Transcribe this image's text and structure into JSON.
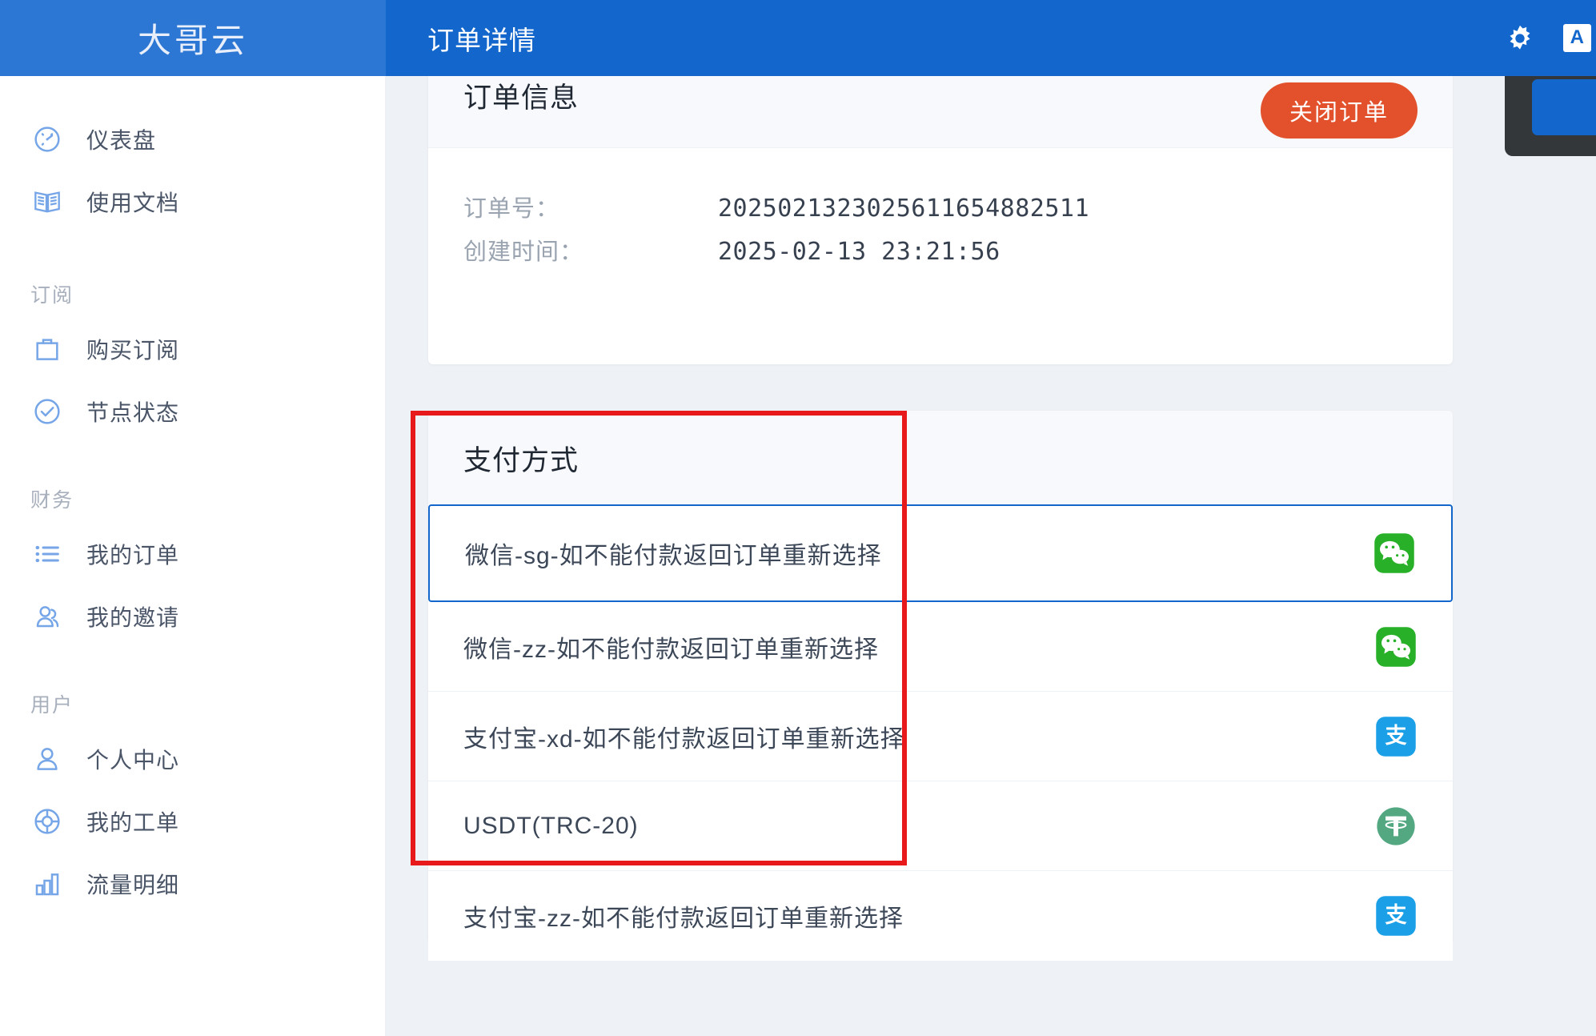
{
  "topbar": {
    "brand": "大哥云",
    "page_title": "订单详情",
    "gear_icon": "gear-icon",
    "lang_badge": "A"
  },
  "sidebar": {
    "groups": [
      {
        "title": "",
        "items": [
          {
            "label": "仪表盘",
            "icon": "gauge-icon"
          },
          {
            "label": "使用文档",
            "icon": "book-icon"
          }
        ]
      },
      {
        "title": "订阅",
        "items": [
          {
            "label": "购买订阅",
            "icon": "shopping-bag-icon"
          },
          {
            "label": "节点状态",
            "icon": "check-circle-icon"
          }
        ]
      },
      {
        "title": "财务",
        "items": [
          {
            "label": "我的订单",
            "icon": "list-icon"
          },
          {
            "label": "我的邀请",
            "icon": "user-group-icon"
          }
        ]
      },
      {
        "title": "用户",
        "items": [
          {
            "label": "个人中心",
            "icon": "user-icon"
          },
          {
            "label": "我的工单",
            "icon": "lifebuoy-icon"
          },
          {
            "label": "流量明细",
            "icon": "bar-chart-icon"
          }
        ]
      }
    ]
  },
  "order_card": {
    "title": "订单信息",
    "close_button": "关闭订单",
    "rows": [
      {
        "key": "订单号：",
        "value": "2025021323025611654882511"
      },
      {
        "key": "创建时间：",
        "value": "2025-02-13 23:21:56"
      }
    ]
  },
  "payment_card": {
    "title": "支付方式",
    "options": [
      {
        "label": "微信-sg-如不能付款返回订单重新选择",
        "icon": "wechat-icon",
        "selected": true
      },
      {
        "label": "微信-zz-如不能付款返回订单重新选择",
        "icon": "wechat-icon",
        "selected": false
      },
      {
        "label": "支付宝-xd-如不能付款返回订单重新选择",
        "icon": "alipay-icon",
        "selected": false
      },
      {
        "label": "USDT(TRC-20)",
        "icon": "usdt-icon",
        "selected": false
      },
      {
        "label": "支付宝-zz-如不能付款返回订单重新选择",
        "icon": "alipay-icon",
        "selected": false
      }
    ]
  },
  "colors": {
    "brand_blue": "#1266cc",
    "brand_blue_light": "#2c76d4",
    "accent_orange": "#e2512b",
    "annotation_red": "#e8191b",
    "wechat_green": "#28b128",
    "alipay_blue": "#1ba0e8",
    "usdt_green": "#53a882",
    "page_bg": "#eef1f6"
  }
}
